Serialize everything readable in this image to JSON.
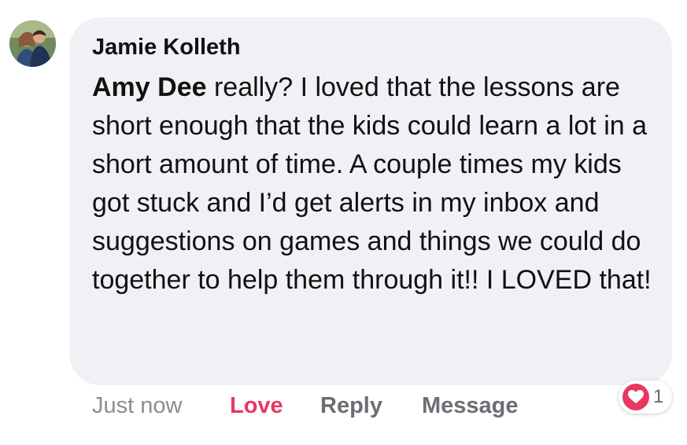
{
  "comment": {
    "author": "Jamie Kolleth",
    "mention": "Amy Dee",
    "text": " really?  I loved that the lessons are short enough that the kids could learn a lot in a short amount of time.  A couple times my kids got stuck and I’d get alerts in my inbox and suggestions on games and things we could do together to help them through it!! I LOVED that!",
    "timestamp": "Just now",
    "actions": {
      "love": "Love",
      "reply": "Reply",
      "message": "Message"
    },
    "reaction": {
      "icon": "heart-icon",
      "count": "1"
    }
  },
  "colors": {
    "bubble": "#eff1f5",
    "love": "#e8385f",
    "action": "#6b6e73",
    "timestamp": "#8a8d91"
  }
}
